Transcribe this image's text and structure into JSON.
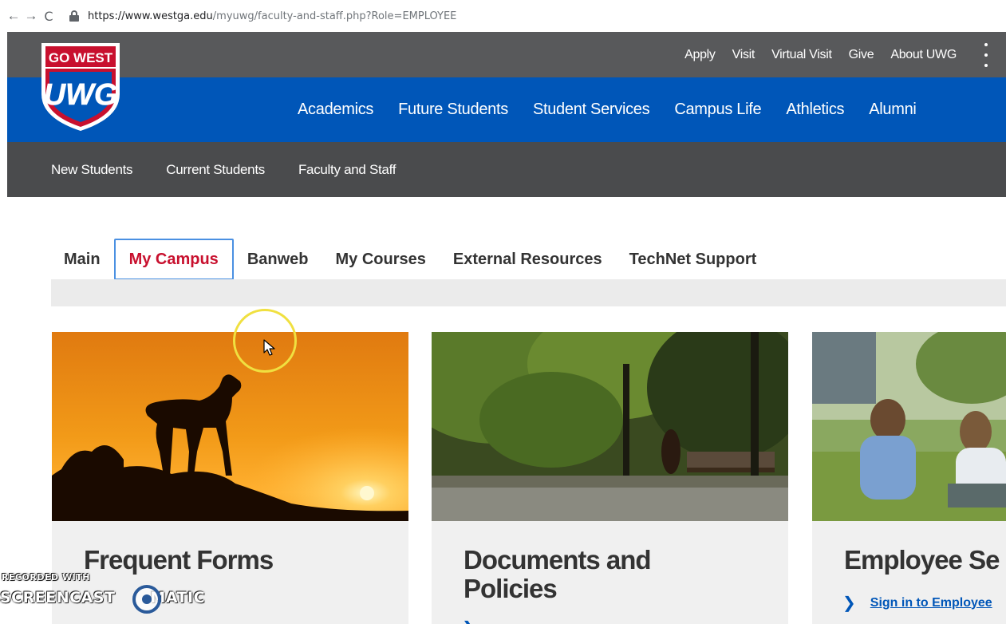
{
  "browser": {
    "back_glyph": "←",
    "forward_glyph": "→",
    "reload_glyph": "C",
    "url_host": "https://www.westga.edu",
    "url_path": "/myuwg/faculty-and-staff.php?Role=EMPLOYEE"
  },
  "logo": {
    "top_text": "GO WEST",
    "main_text": "UWG",
    "colors": {
      "red": "#c8102e",
      "blue": "#0056b8"
    }
  },
  "utility_nav": {
    "items": [
      "Apply",
      "Visit",
      "Virtual Visit",
      "Give",
      "About UWG"
    ],
    "menu_icon": "kebab-menu-icon"
  },
  "main_nav": {
    "items": [
      "Academics",
      "Future Students",
      "Student Services",
      "Campus Life",
      "Athletics",
      "Alumni"
    ]
  },
  "audience_nav": {
    "items": [
      "New Students",
      "Current Students",
      "Faculty and Staff"
    ]
  },
  "tabs": {
    "items": [
      "Main",
      "My Campus",
      "Banweb",
      "My Courses",
      "External Resources",
      "TechNet Support"
    ],
    "active": "My Campus"
  },
  "cards": [
    {
      "title_line1": "Frequent Forms",
      "title_line2": "",
      "link": "",
      "image": "wolf-sunset-photo"
    },
    {
      "title_line1": "Documents and",
      "title_line2": "Policies",
      "link": "",
      "image": "campus-park-photo"
    },
    {
      "title_line1": "Employee Se",
      "title_line2": "",
      "link": "Sign in to Employee",
      "image": "students-lawn-photo"
    }
  ],
  "watermark": {
    "line1": "RECORDED WITH",
    "line2": "SCREENCAST",
    "line3": "MATIC"
  },
  "theme": {
    "utility_bg": "#58595b",
    "main_nav_bg": "#0056b8",
    "sub_nav_bg": "#4a4b4d",
    "active_tab_text": "#c8102e",
    "active_tab_border": "#4a90e2",
    "link_blue": "#0056b8"
  }
}
